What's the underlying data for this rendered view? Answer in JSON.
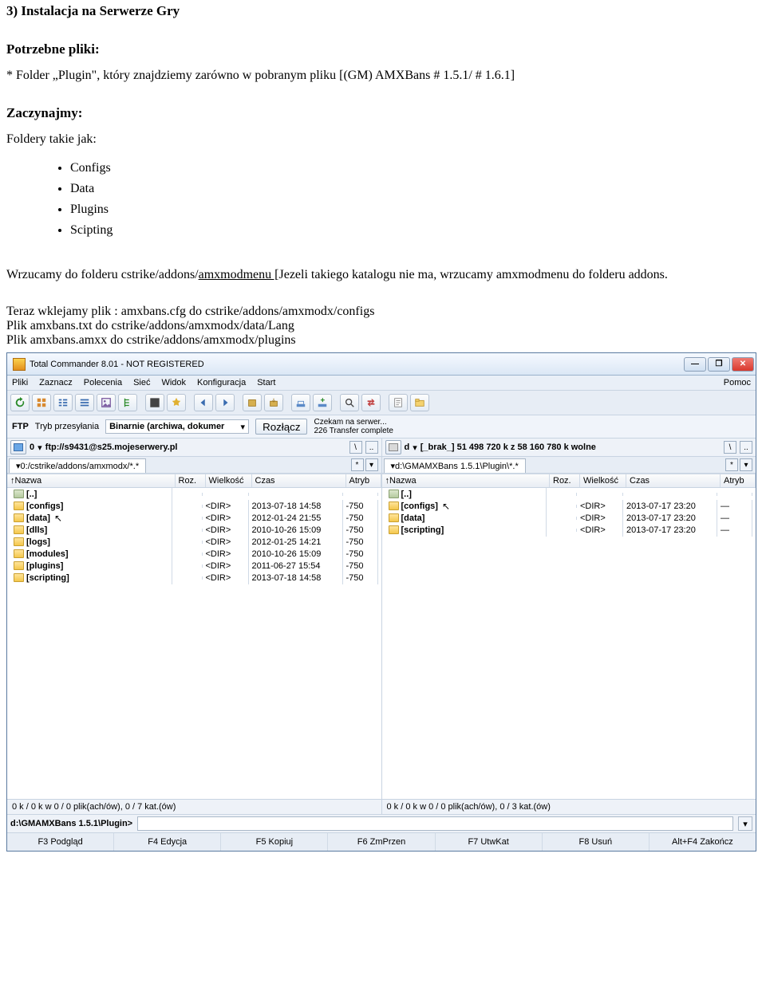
{
  "doc": {
    "heading": "3) Instalacja na Serwerze Gry",
    "sub1": "Potrzebne pliki:",
    "p1": "* Folder „Plugin\", który znajdziemy zarówno w pobranym pliku [(GM) AMXBans # 1.5.1/ # 1.6.1]",
    "sub2": "Zaczynajmy:",
    "list_intro": "Foldery takie jak:",
    "bullets": [
      "Configs",
      "Data",
      "Plugins",
      "Scipting"
    ],
    "wrzucamy_pre": "Wrzucamy do folderu cstrike/addons/",
    "wrzucamy_underline": "amxmodmenu [",
    "wrzucamy_post": "Jezeli takiego katalogu nie ma, wrzucamy amxmodmenu do folderu addons.",
    "teraz": "Teraz wklejamy plik : amxbans.cfg do cstrike/addons/amxmodx/configs",
    "plik1": "Plik amxbans.txt do cstrike/addons/amxmodx/data/Lang",
    "plik2": "Plik amxbans.amxx do cstrike/addons/amxmodx/plugins"
  },
  "tc": {
    "title": "Total Commander 8.01 - NOT REGISTERED",
    "menu": [
      "Pliki",
      "Zaznacz",
      "Polecenia",
      "Sieć",
      "Widok",
      "Konfiguracja",
      "Start"
    ],
    "menu_right": "Pomoc",
    "ftp": {
      "label": "FTP",
      "transfer_label": "Tryb przesyłania",
      "transfer_value": "Binarnie (archiwa, dokumer",
      "disconnect": "Rozłącz",
      "status1": "Czekam na serwer...",
      "status2": "226 Transfer complete"
    },
    "left": {
      "drive": "0",
      "drive_text": "ftp://s9431@s25.mojeserwery.pl",
      "tab": "0:/cstrike/addons/amxmodx/*.*",
      "cols": {
        "name": "Nazwa",
        "ext": "Roz.",
        "size": "Wielkość",
        "date": "Czas",
        "attr": "Atryb"
      },
      "rows": [
        {
          "name": "[..]",
          "up": true,
          "ext": "",
          "size": "",
          "date": "",
          "attr": ""
        },
        {
          "name": "[configs]",
          "ext": "",
          "size": "<DIR>",
          "date": "2013-07-18 14:58",
          "attr": "-750"
        },
        {
          "name": "[data]",
          "cursor": true,
          "ext": "",
          "size": "<DIR>",
          "date": "2012-01-24 21:55",
          "attr": "-750"
        },
        {
          "name": "[dlls]",
          "ext": "",
          "size": "<DIR>",
          "date": "2010-10-26 15:09",
          "attr": "-750"
        },
        {
          "name": "[logs]",
          "ext": "",
          "size": "<DIR>",
          "date": "2012-01-25 14:21",
          "attr": "-750"
        },
        {
          "name": "[modules]",
          "ext": "",
          "size": "<DIR>",
          "date": "2010-10-26 15:09",
          "attr": "-750"
        },
        {
          "name": "[plugins]",
          "ext": "",
          "size": "<DIR>",
          "date": "2011-06-27 15:54",
          "attr": "-750"
        },
        {
          "name": "[scripting]",
          "ext": "",
          "size": "<DIR>",
          "date": "2013-07-18 14:58",
          "attr": "-750"
        }
      ],
      "status": "0 k / 0 k w 0 / 0 plik(ach/ów), 0 / 7 kat.(ów)"
    },
    "right": {
      "drive": "d",
      "drive_text": "[_brak_]  51 498 720 k z 58 160 780 k wolne",
      "tab": "d:\\GMAMXBans 1.5.1\\Plugin\\*.*",
      "cols": {
        "name": "Nazwa",
        "ext": "Roz.",
        "size": "Wielkość",
        "date": "Czas",
        "attr": "Atryb"
      },
      "rows": [
        {
          "name": "[..]",
          "up": true,
          "ext": "",
          "size": "",
          "date": "",
          "attr": ""
        },
        {
          "name": "[configs]",
          "cursor": true,
          "ext": "",
          "size": "<DIR>",
          "date": "2013-07-17 23:20",
          "attr": "—"
        },
        {
          "name": "[data]",
          "ext": "",
          "size": "<DIR>",
          "date": "2013-07-17 23:20",
          "attr": "—"
        },
        {
          "name": "[scripting]",
          "ext": "",
          "size": "<DIR>",
          "date": "2013-07-17 23:20",
          "attr": "—"
        }
      ],
      "status": "0 k / 0 k w 0 / 0 plik(ach/ów), 0 / 3 kat.(ów)"
    },
    "cmd_path": "d:\\GMAMXBans 1.5.1\\Plugin>",
    "fkeys": [
      "F3 Podgląd",
      "F4 Edycja",
      "F5 Kopiuj",
      "F6 ZmPrzen",
      "F7 UtwKat",
      "F8 Usuń",
      "Alt+F4 Zakończ"
    ]
  }
}
